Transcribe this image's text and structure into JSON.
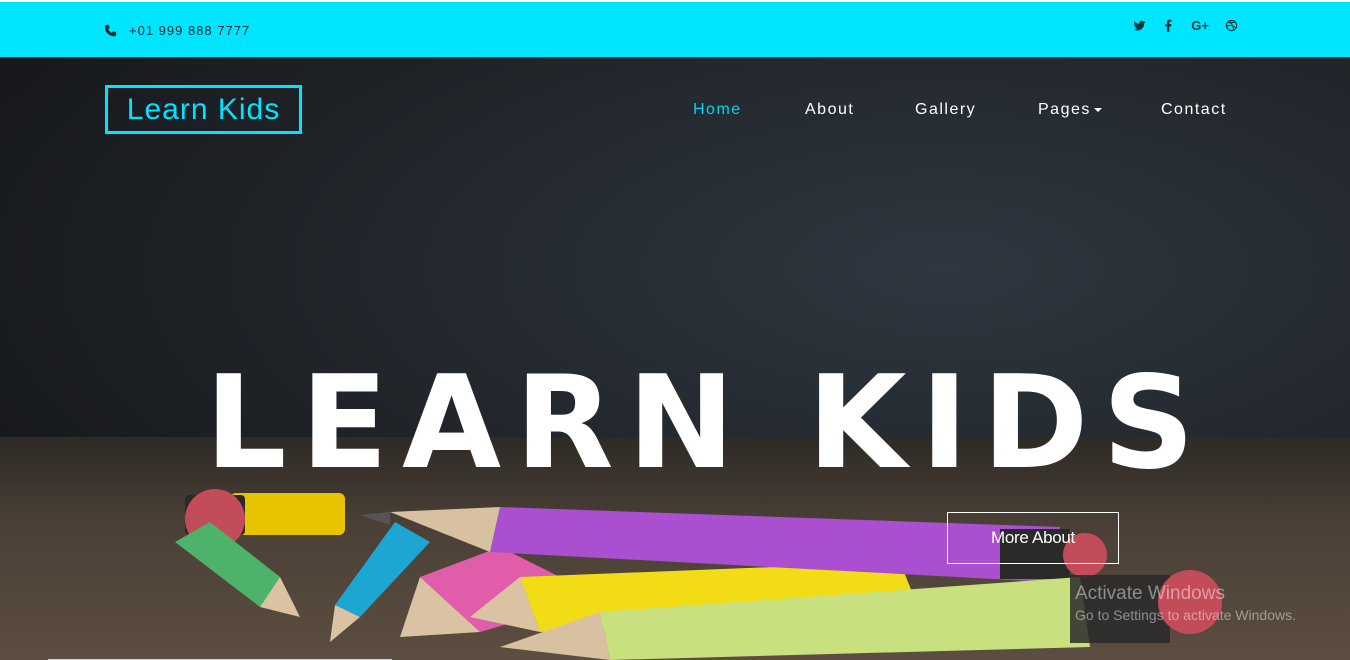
{
  "topbar": {
    "phone": "+01 999 888 7777",
    "social_icons": [
      "twitter-icon",
      "facebook-icon",
      "google-plus-icon",
      "dribbble-icon"
    ],
    "google_plus_label": "G+"
  },
  "header": {
    "logo": "Learn Kids",
    "nav": [
      {
        "label": "Home",
        "active": true
      },
      {
        "label": "About"
      },
      {
        "label": "Gallery"
      },
      {
        "label": "Pages"
      },
      {
        "label": "Contact"
      }
    ]
  },
  "hero": {
    "title": "LEARN KIDS",
    "button": "More About"
  },
  "os_overlay": {
    "line1": "Activate Windows",
    "line2": "Go to Settings to activate Windows."
  },
  "colors": {
    "accent": "#00e5ff",
    "nav_active": "#00d4ef",
    "hero_text": "#ffffff"
  }
}
